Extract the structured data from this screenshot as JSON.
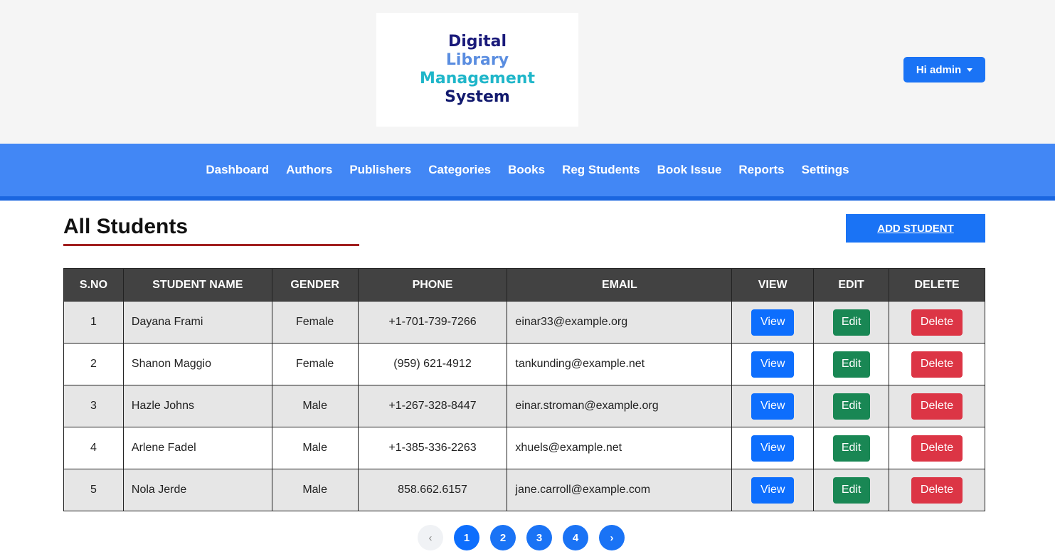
{
  "logo": {
    "lines": [
      "Digital",
      "Library",
      "Management",
      "System"
    ]
  },
  "user": {
    "label": "Hi admin"
  },
  "nav": {
    "items": [
      "Dashboard",
      "Authors",
      "Publishers",
      "Categories",
      "Books",
      "Reg Students",
      "Book Issue",
      "Reports",
      "Settings"
    ]
  },
  "page": {
    "title": "All Students",
    "add_button": "ADD STUDENT"
  },
  "table": {
    "headers": [
      "S.NO",
      "STUDENT NAME",
      "GENDER",
      "PHONE",
      "EMAIL",
      "VIEW",
      "EDIT",
      "DELETE"
    ],
    "rows": [
      {
        "sno": "1",
        "name": "Dayana Frami",
        "gender": "Female",
        "phone": "+1-701-739-7266",
        "email": "einar33@example.org",
        "view": "View",
        "edit": "Edit",
        "delete": "Delete"
      },
      {
        "sno": "2",
        "name": "Shanon Maggio",
        "gender": "Female",
        "phone": "(959) 621-4912",
        "email": "tankunding@example.net",
        "view": "View",
        "edit": "Edit",
        "delete": "Delete"
      },
      {
        "sno": "3",
        "name": "Hazle Johns",
        "gender": "Male",
        "phone": "+1-267-328-8447",
        "email": "einar.stroman@example.org",
        "view": "View",
        "edit": "Edit",
        "delete": "Delete"
      },
      {
        "sno": "4",
        "name": "Arlene Fadel",
        "gender": "Male",
        "phone": "+1-385-336-2263",
        "email": "xhuels@example.net",
        "view": "View",
        "edit": "Edit",
        "delete": "Delete"
      },
      {
        "sno": "5",
        "name": "Nola Jerde",
        "gender": "Male",
        "phone": "858.662.6157",
        "email": "jane.carroll@example.com",
        "view": "View",
        "edit": "Edit",
        "delete": "Delete"
      }
    ]
  },
  "pagination": {
    "prev": "‹",
    "pages": [
      "1",
      "2",
      "3",
      "4"
    ],
    "next": "›",
    "current": "1"
  },
  "colors": {
    "primary": "#1a73f5",
    "nav": "#4287f5",
    "success": "#198754",
    "danger": "#dc3545",
    "header_bg": "#424242",
    "accent_underline": "#a11f1f"
  }
}
